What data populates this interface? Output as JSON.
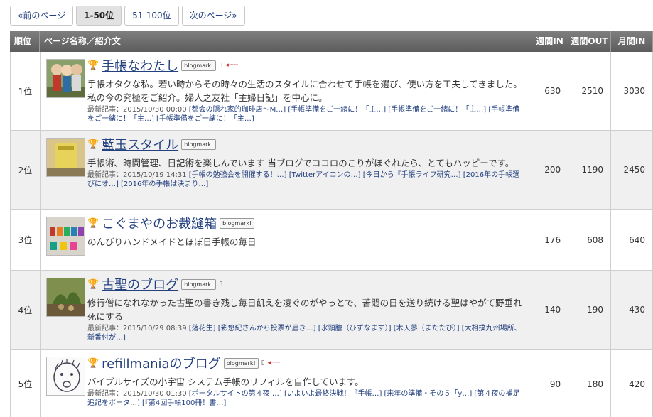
{
  "pager": {
    "prev": "«前のページ",
    "current": "1-50位",
    "next_range": "51-100位",
    "next": "次のページ»"
  },
  "headers": {
    "rank": "順位",
    "page": "ページ名称／紹介文",
    "in": "週間IN",
    "out": "週間OUT",
    "month": "月間IN"
  },
  "badges": {
    "blogmark": "blogmark!"
  },
  "rows": [
    {
      "rank": "1位",
      "title": "手帳なわたし",
      "desc": "手帳オタクな私。若い時からその時々の生活のスタイルに合わせて手帳を選び、使い方を工夫してきました。私の今の究極をご紹介。婦人之友社「主婦日記」を中心に。",
      "latest_label": "最新記事：2015/10/30 00:00",
      "latest_links": "[都会の隠れ家的珈琲店～M…] [手帳準備をご一緒に！「主…] [手帳準備をご一緒に！「主…] [手帳準備をご一緒に！「主…] [手帳準備をご一緒に！「主…]",
      "in": "630",
      "out": "2510",
      "month": "3030"
    },
    {
      "rank": "2位",
      "title": "藍玉スタイル",
      "desc": "手帳術、時間管理、日記術を楽しんでいます 当ブログでココロのこりがほぐれたら、とてもハッピーです。",
      "latest_label": "最新記事：2015/10/19 14:31",
      "latest_links": "[手帳の勉強会を開催する！…] [Twitterアイコンの…] [今日から『手帳ライフ研究…] [2016年の手帳選びにオ…] [2016年の手帳は決まり…]",
      "in": "200",
      "out": "1190",
      "month": "2450"
    },
    {
      "rank": "3位",
      "title": "こぐまやのお裁縫箱",
      "desc": "のんびりハンドメイドとほぼ日手帳の毎日",
      "latest_label": "",
      "latest_links": "",
      "in": "176",
      "out": "608",
      "month": "640"
    },
    {
      "rank": "4位",
      "title": "古聖のブログ",
      "desc": "修行僧になれなかった古聖の書き残し毎日飢えを凌ぐのがやっとで、苦悶の日を送り続ける聖はやがて野垂れ死にする",
      "latest_label": "最新記事：2015/10/29 08:39",
      "latest_links": "[落花生] [彩悠紀さんから投票が届き…] [氷頭膾（ひずなます）] [木天蓼（またたび）] [大相撲九州場所、新番付が…]",
      "in": "140",
      "out": "190",
      "month": "430"
    },
    {
      "rank": "5位",
      "title": "refillmaniaのブログ",
      "desc": "バイブルサイズの小宇宙 システム手帳のリフィルを自作しています。",
      "latest_label": "最新記事：2015/10/30 01:30",
      "latest_links": "[ポータルサイトの第４夜 …] [いよいよ最終決戦！『手帳…] [来年の準備・その５「y…] [第４夜の補足追記をポータ…] [『第4回手帳100冊！書…]",
      "in": "90",
      "out": "180",
      "month": "420"
    }
  ]
}
